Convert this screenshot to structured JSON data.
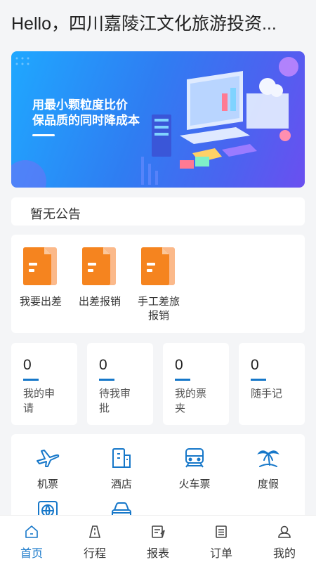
{
  "header": {
    "title": "Hello，四川嘉陵江文化旅游投资..."
  },
  "banner": {
    "line1": "用最小颗粒度比价",
    "line2": "保品质的同时降成本"
  },
  "notice": {
    "text": "暂无公告"
  },
  "apps": [
    {
      "label": "我要出差",
      "icon": "document-icon"
    },
    {
      "label": "出差报销",
      "icon": "document-icon"
    },
    {
      "label": "手工差旅报销",
      "icon": "document-icon"
    }
  ],
  "stats": [
    {
      "value": "0",
      "label": "我的申请"
    },
    {
      "value": "0",
      "label": "待我审批"
    },
    {
      "value": "0",
      "label": "我的票夹"
    },
    {
      "value": "0",
      "label": "随手记"
    }
  ],
  "services": [
    {
      "label": "机票",
      "icon": "airplane-icon"
    },
    {
      "label": "酒店",
      "icon": "hotel-icon"
    },
    {
      "label": "火车票",
      "icon": "train-icon"
    },
    {
      "label": "度假",
      "icon": "palm-tree-icon"
    },
    {
      "label": "",
      "icon": "globe-icon"
    },
    {
      "label": "",
      "icon": "car-icon"
    }
  ],
  "tabbar": [
    {
      "label": "首页",
      "icon": "home-icon",
      "active": true
    },
    {
      "label": "行程",
      "icon": "road-icon",
      "active": false
    },
    {
      "label": "报表",
      "icon": "report-icon",
      "active": false
    },
    {
      "label": "订单",
      "icon": "order-icon",
      "active": false
    },
    {
      "label": "我的",
      "icon": "user-icon",
      "active": false
    }
  ],
  "colors": {
    "accent": "#1677c9",
    "doc_orange": "#f5841f",
    "background": "#f4f5f7"
  }
}
